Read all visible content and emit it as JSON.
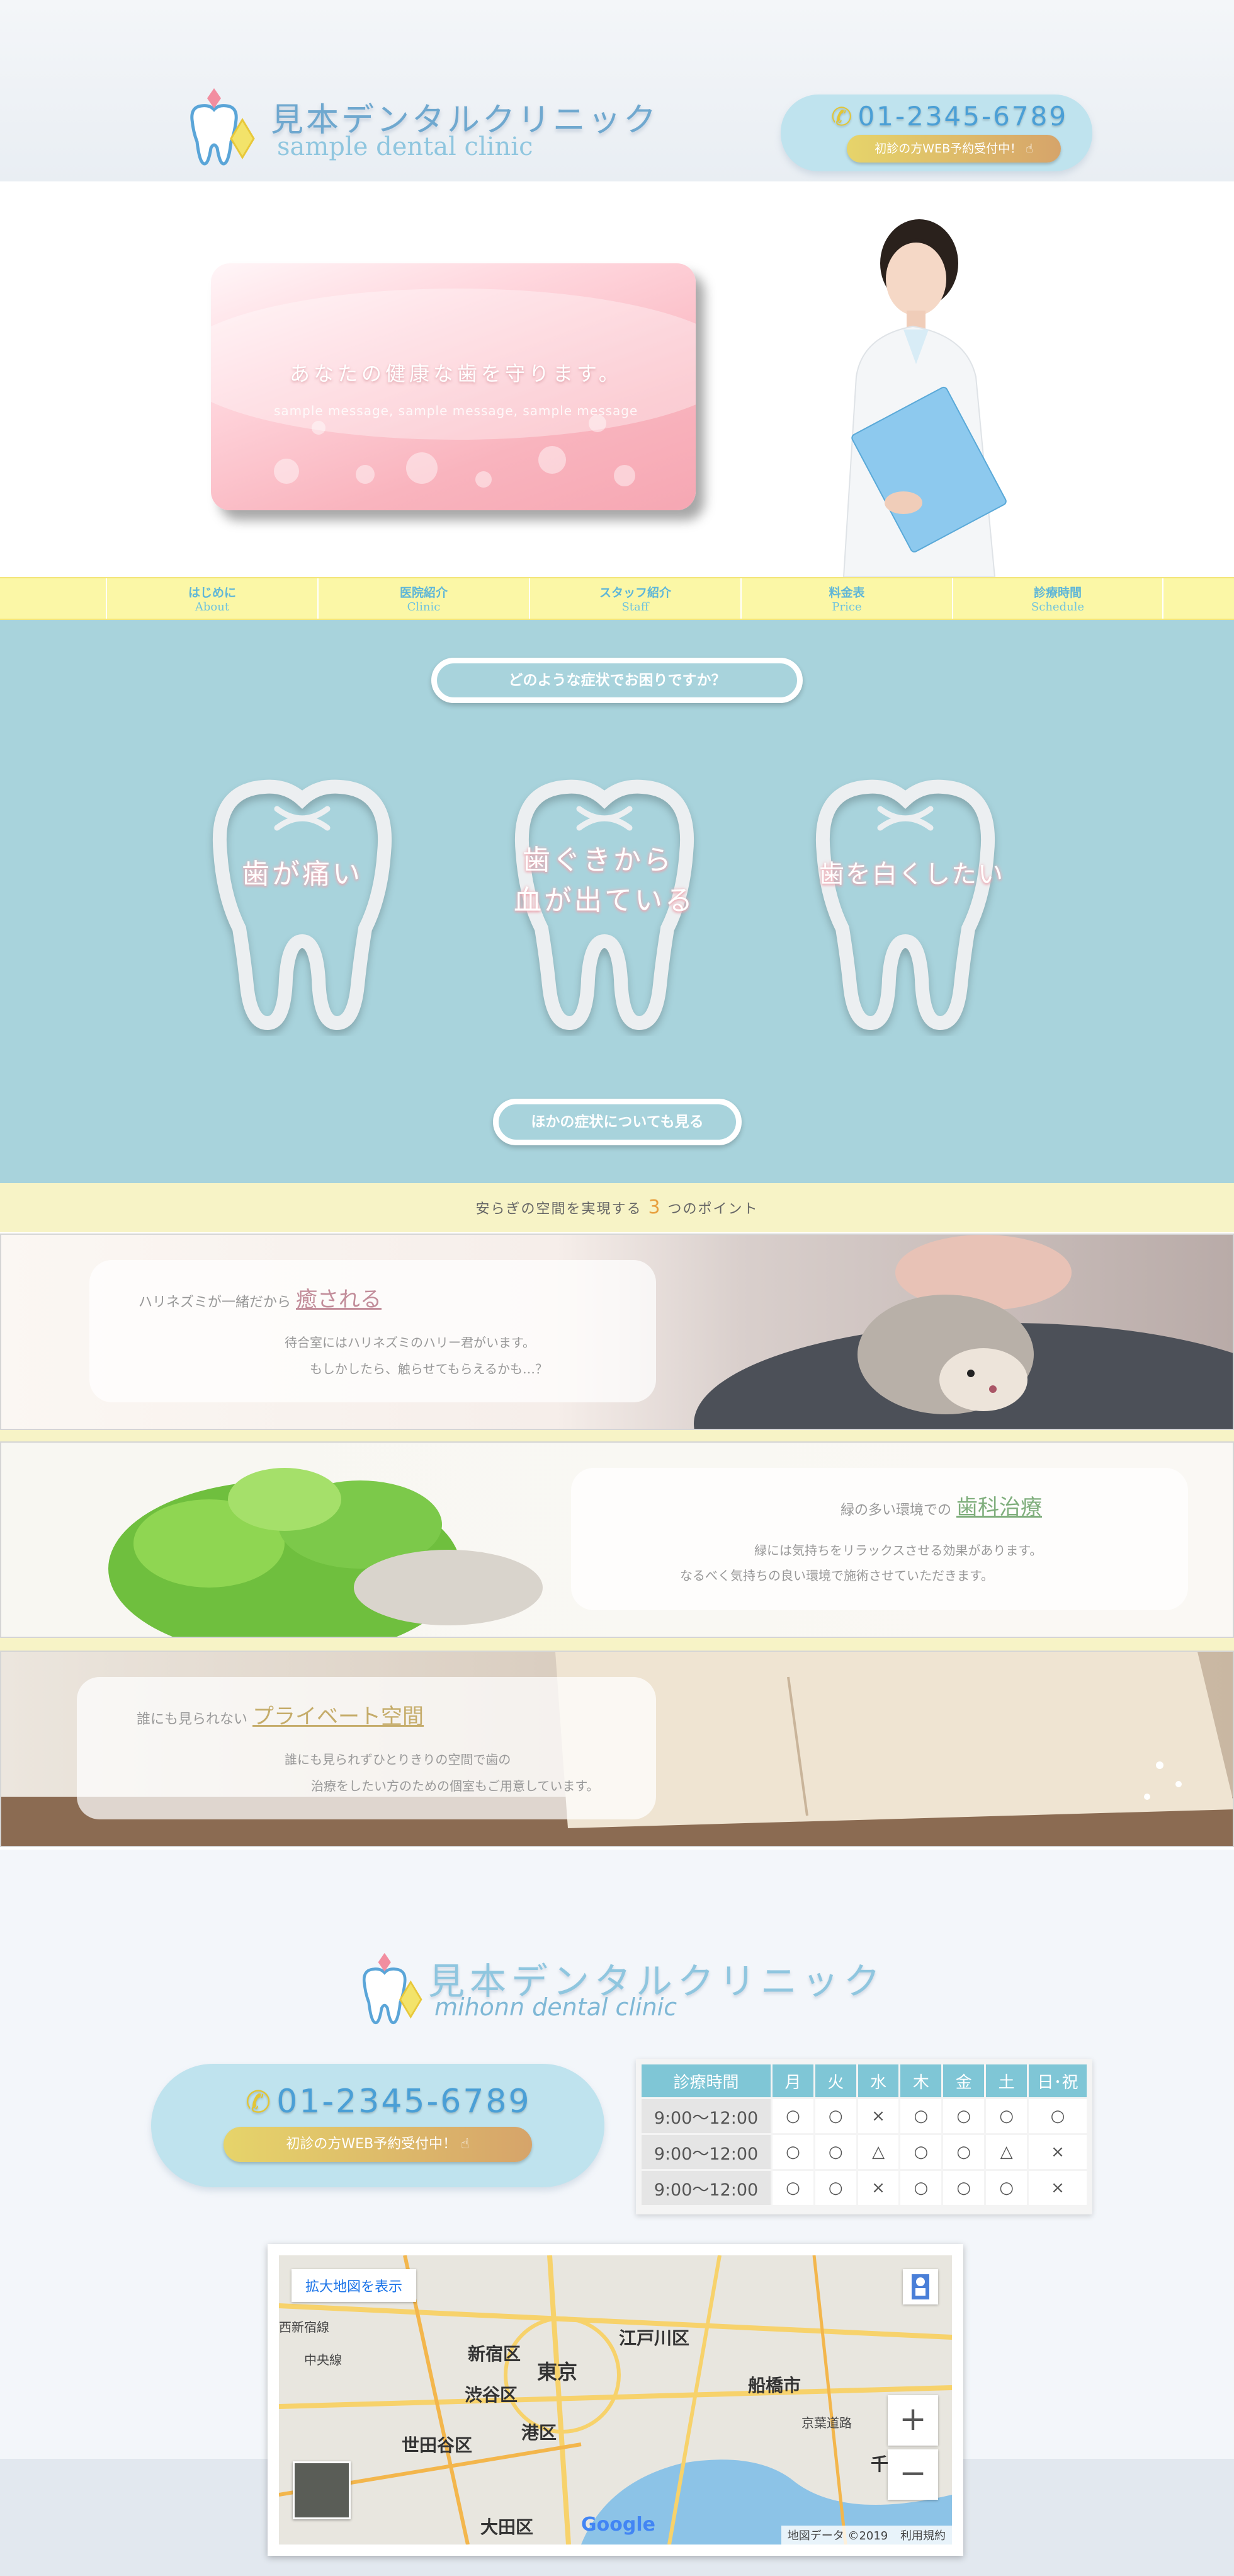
{
  "header": {
    "logo_ja": "見本デンタルクリニック",
    "logo_en": "sample dental clinic",
    "phone": "01-2345-6789",
    "reserve_label": "初診の方WEB予約受付中！"
  },
  "hero": {
    "message": "あなたの健康な歯を守ります。",
    "sub_message": "sample message, sample message, sample message"
  },
  "nav": {
    "items": [
      {
        "ja": "はじめに",
        "en": "About"
      },
      {
        "ja": "医院紹介",
        "en": "Clinic"
      },
      {
        "ja": "スタッフ紹介",
        "en": "Staff"
      },
      {
        "ja": "料金表",
        "en": "Price"
      },
      {
        "ja": "診療時間",
        "en": "Schedule"
      }
    ]
  },
  "symptoms": {
    "question": "どのような症状でお困りですか？",
    "items": [
      {
        "line1": "歯が痛い",
        "line2": ""
      },
      {
        "line1": "歯ぐきから",
        "line2": "血が出ている"
      },
      {
        "line1": "歯を白くしたい",
        "line2": ""
      }
    ],
    "more_label": "ほかの症状についても見る"
  },
  "points": {
    "title_pre": "安らぎの空間を実現する",
    "title_num": "3",
    "title_post": "つのポイント",
    "items": [
      {
        "lead": "ハリネズミが一緒だから",
        "emphasis": "癒される",
        "body1": "待合室にはハリネズミのハリー君がいます。",
        "body2": "もしかしたら、触らせてもらえるかも…？"
      },
      {
        "lead": "緑の多い環境での",
        "emphasis": "歯科治療",
        "body1": "緑には気持ちをリラックスさせる効果があります。",
        "body2": "なるべく気持ちの良い環境で施術させていただきます。"
      },
      {
        "lead": "誰にも見られない",
        "emphasis": "プライベート空間",
        "body1": "誰にも見られずひとりきりの空間で歯の",
        "body2": "治療をしたい方のための個室もご用意しています。"
      }
    ]
  },
  "footer": {
    "logo_ja": "見本デンタルクリニック",
    "logo_en": "mihonn dental clinic",
    "phone": "01-2345-6789",
    "reserve_label": "初診の方WEB予約受付中！"
  },
  "schedule": {
    "headers": [
      "診療時間",
      "月",
      "火",
      "水",
      "木",
      "金",
      "土",
      "日･祝"
    ],
    "rows": [
      [
        "9:00～12:00",
        "○",
        "○",
        "×",
        "○",
        "○",
        "○",
        "○"
      ],
      [
        "9:00～12:00",
        "○",
        "○",
        "△",
        "○",
        "○",
        "△",
        "×"
      ],
      [
        "9:00～12:00",
        "○",
        "○",
        "×",
        "○",
        "○",
        "○",
        "×"
      ]
    ]
  },
  "map": {
    "enlarge_label": "拡大地図を表示",
    "labels": [
      "西新宿線",
      "中央線",
      "新宿区",
      "東京",
      "江戸川区",
      "渋谷区",
      "船橋市",
      "港区",
      "世田谷区",
      "大田区",
      "京葉道路",
      "千"
    ],
    "footer_data": "地図データ ©2019",
    "footer_terms": "利用規約",
    "google": "Google",
    "zoom_in": "+",
    "zoom_out": "−",
    "colors": {
      "water": "#8cc3e7",
      "road": "#f7d26b",
      "land": "#e8e6df"
    }
  },
  "colors": {
    "accent_blue": "#4a9fd6",
    "nav_yellow": "#fbf7a6",
    "symptom_bg": "#a8d3dc",
    "hero_pink": "#f6a7b3"
  }
}
